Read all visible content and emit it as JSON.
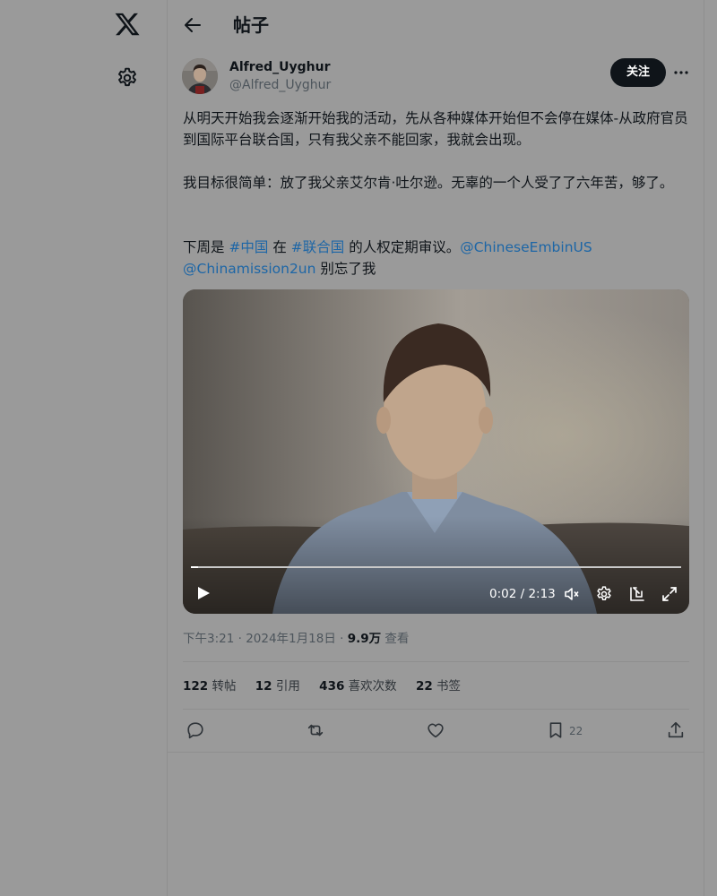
{
  "page": {
    "title": "帖子"
  },
  "post": {
    "author_name": "Alfred_Uyghur",
    "author_handle": "@Alfred_Uyghur",
    "follow_label": "关注",
    "para1": "从明天开始我会逐渐开始我的活动，先从各种媒体开始但不会停在媒体-从政府官员到国际平台联合国，只有我父亲不能回家，我就会出现。",
    "para2": "我目标很简单：放了我父亲艾尔肯·吐尔逊。无辜的一个人受了了六年苦，够了。",
    "para3_a": "下周是 ",
    "para3_tag1": "#中国",
    "para3_b": " 在 ",
    "para3_tag2": "#联合国",
    "para3_c": " 的人权定期审议。",
    "para3_mention1": "@ChineseEmbinUS",
    "para3_mention2": "@Chinamission2un",
    "para3_d": " 别忘了我"
  },
  "video": {
    "time": "0:02 / 2:13",
    "progress": 0.015
  },
  "meta": {
    "time": "下午3:21 · 2024年1月18日 · ",
    "views": "9.9万",
    "views_label": " 查看"
  },
  "stats": {
    "reposts": "122",
    "reposts_label": "转帖",
    "quotes": "12",
    "quotes_label": "引用",
    "likes": "436",
    "likes_label": "喜欢次数",
    "bookmarks": "22",
    "bookmarks_label": "书签"
  },
  "actions": {
    "bookmark_count": "22"
  }
}
